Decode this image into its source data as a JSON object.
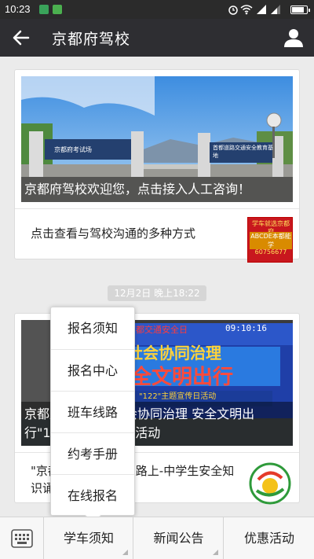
{
  "status_bar": {
    "time": "10:23"
  },
  "header": {
    "title": "京都府驾校"
  },
  "card1": {
    "banner_caption": "京都府驾校欢迎您，点击接入人工咨询！",
    "gate_sign_left": "京都府考试场",
    "gate_sign_right": "首都道路交通安全教育基地",
    "row_text": "点击查看与驾校沟通的多种方式",
    "thumb_lines": [
      "学车就选京都府",
      "ABCDE本都能学",
      "60756677"
    ]
  },
  "timestamp": "12月2日 晚上18:22",
  "card2": {
    "screen_top": "首都交通安全日",
    "screen_clock": "09:10:16",
    "screen_line1": "社会协同治理",
    "screen_line2": "全文明出行",
    "screen_line3": "\"122\"主题宣传日活动",
    "banner_caption": "京都府驾校参加社会协同治理 安全文明出行\"122\"主题宣传日活动",
    "row_text": "\"京都府驾校\"平安在路上-中学生安全知识诵朗诵比赛"
  },
  "popup_menu": {
    "items": [
      "报名须知",
      "报名中心",
      "班车线路",
      "约考手册",
      "在线报名"
    ]
  },
  "bottom_menu": {
    "items": [
      "学车须知",
      "新闻公告",
      "优惠活动"
    ]
  },
  "colors": {
    "header_bg": "#2e2e32",
    "status_bg": "#2b2b2b",
    "page_bg": "#ebebeb"
  }
}
